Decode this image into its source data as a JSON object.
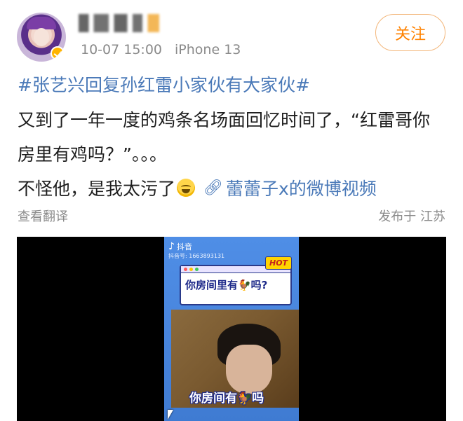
{
  "post": {
    "author": {
      "name": "蕾蕾子x",
      "avatar_icon": "avatar-portrait",
      "verified_badge_color": "#ffb400"
    },
    "timestamp": "10-07 15:00",
    "device": "iPhone 13",
    "follow_label": "关注",
    "hashtag": "#张艺兴回复孙红雷小家伙有大家伙#",
    "body_line1": "又到了一年一度的鸡条名场面回忆时间了，“红雷哥你",
    "body_line2": "房里有鸡吗？”。。。",
    "body_line3": "不怪他，是我太污了",
    "link_icon": "link-icon",
    "link_text": "蕾蕾子x的微博视频",
    "translate_label": "查看翻译",
    "location": "发布于 江苏"
  },
  "video": {
    "platform_label": "抖音",
    "platform_id": "抖音号: 1663893131",
    "card_text": "你房间里有🐓吗?",
    "hot_badge": "HOT",
    "subtitle": "你房间有🐓吗"
  },
  "colors": {
    "accent_orange": "#ff8200",
    "link_blue": "#4a79b8",
    "meta_gray": "#8a8a8a"
  }
}
